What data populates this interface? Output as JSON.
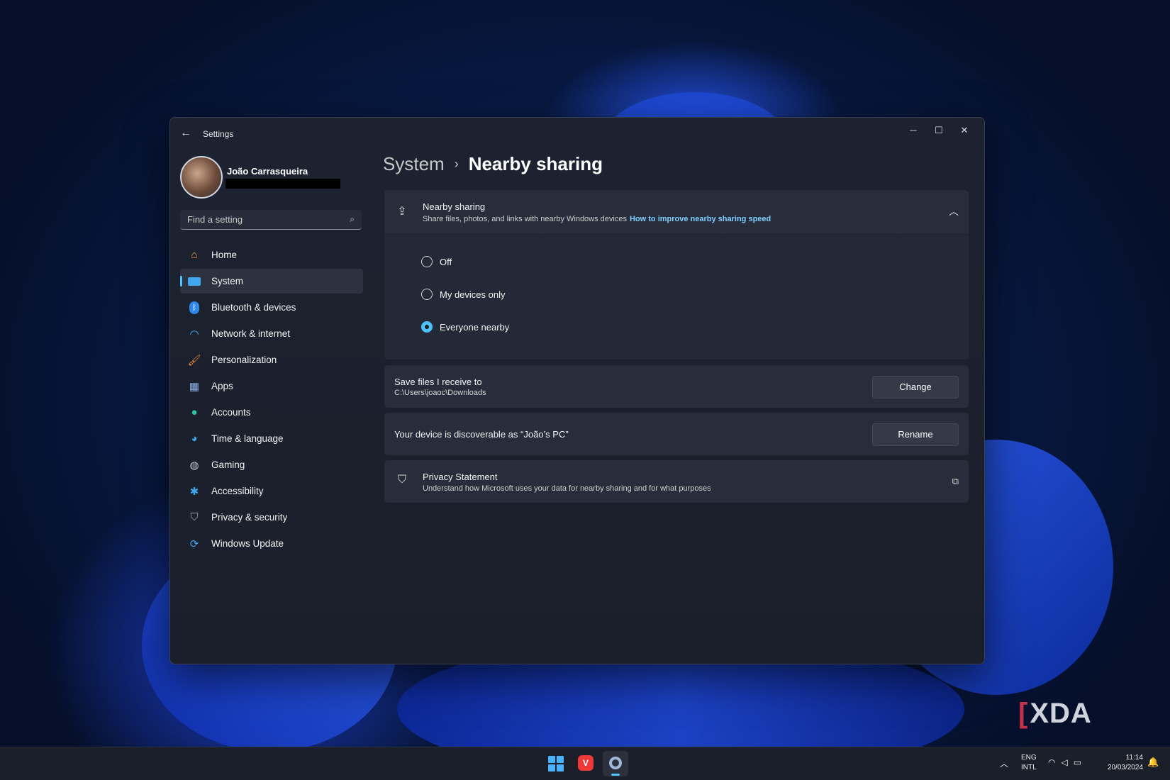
{
  "window": {
    "title": "Settings"
  },
  "user": {
    "name": "João Carrasqueira"
  },
  "search": {
    "placeholder": "Find a setting"
  },
  "nav": [
    {
      "label": "Home",
      "icon": "home-icon"
    },
    {
      "label": "System",
      "icon": "system-icon",
      "active": true
    },
    {
      "label": "Bluetooth & devices",
      "icon": "bluetooth-icon"
    },
    {
      "label": "Network & internet",
      "icon": "wifi-icon"
    },
    {
      "label": "Personalization",
      "icon": "brush-icon"
    },
    {
      "label": "Apps",
      "icon": "apps-icon"
    },
    {
      "label": "Accounts",
      "icon": "accounts-icon"
    },
    {
      "label": "Time & language",
      "icon": "globe-clock-icon"
    },
    {
      "label": "Gaming",
      "icon": "gamepad-icon"
    },
    {
      "label": "Accessibility",
      "icon": "accessibility-icon"
    },
    {
      "label": "Privacy & security",
      "icon": "shield-icon"
    },
    {
      "label": "Windows Update",
      "icon": "update-icon"
    }
  ],
  "breadcrumb": {
    "parent": "System",
    "separator": "›",
    "current": "Nearby sharing"
  },
  "nearby": {
    "title": "Nearby sharing",
    "subtitle": "Share files, photos, and links with nearby Windows devices",
    "link": "How to improve nearby sharing speed",
    "options": [
      "Off",
      "My devices only",
      "Everyone nearby"
    ],
    "selected": "Everyone nearby"
  },
  "save_files": {
    "title": "Save files I receive to",
    "path": "C:\\Users\\joaoc\\Downloads",
    "button": "Change"
  },
  "discoverable": {
    "text": "Your device is discoverable as “João’s PC”",
    "button": "Rename"
  },
  "privacy": {
    "title": "Privacy Statement",
    "subtitle": "Understand how Microsoft uses your data for nearby sharing and for what purposes"
  },
  "taskbar": {
    "lang1": "ENG",
    "lang2": "INTL",
    "time": "11:14",
    "date": "20/03/2024"
  },
  "watermark": "XDA",
  "colors": {
    "accent": "#4cc2ff",
    "link": "#7fd0ff"
  }
}
